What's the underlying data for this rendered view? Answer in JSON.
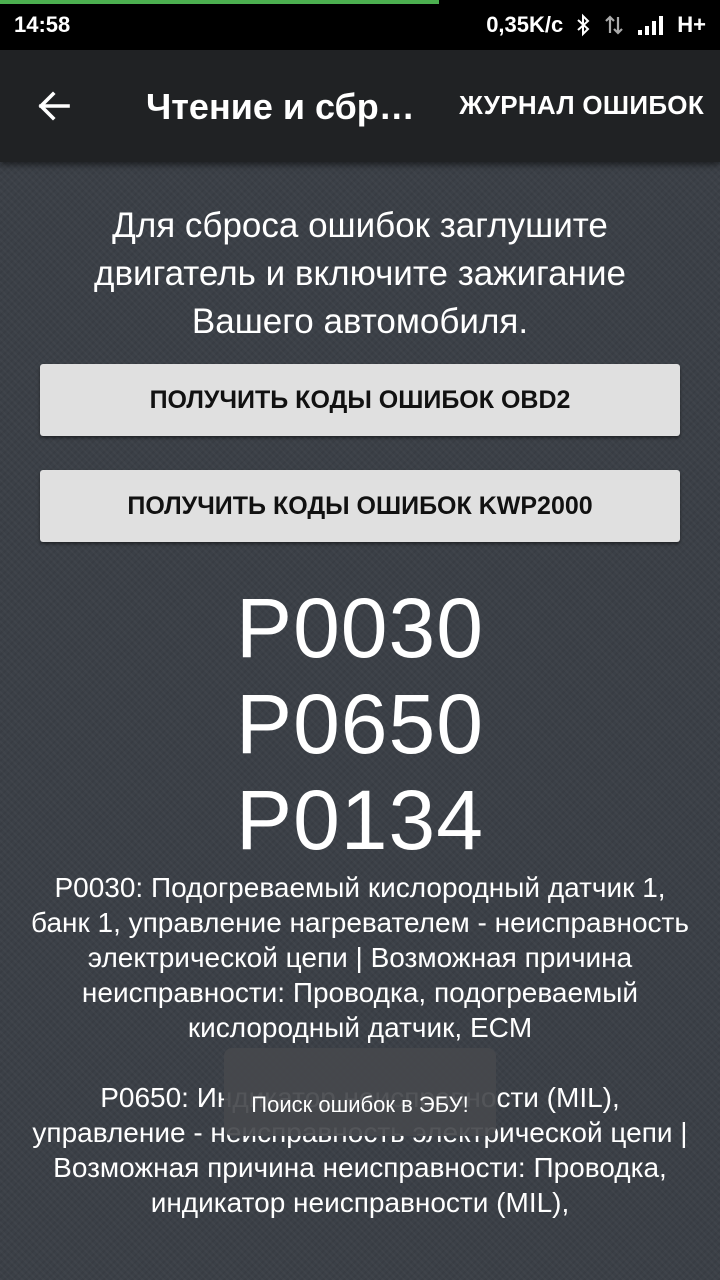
{
  "status_bar": {
    "time": "14:58",
    "network_speed": "0,35K/c",
    "network_type": "H+",
    "icons": [
      "bluetooth-icon",
      "data-transfer-icon",
      "signal-icon"
    ]
  },
  "app_bar": {
    "back_icon": "arrow-back-icon",
    "title": "Чтение и сброс ошибок",
    "journal_label": "ЖУРНАЛ ОШИБОК"
  },
  "main": {
    "instruction": "Для сброса ошибок заглушите двигатель и включите зажигание Вашего автомобиля.",
    "buttons": {
      "obd2": "ПОЛУЧИТЬ КОДЫ ОШИБОК OBD2",
      "kwp2000": "ПОЛУЧИТЬ КОДЫ ОШИБОК KWP2000"
    },
    "codes": [
      "P0030",
      "P0650",
      "P0134"
    ],
    "descriptions": [
      "P0030: Подогреваемый кислородный датчик 1, банк 1, управление нагревателем - неисправность электрической цепи | Возможная причина неисправности: Проводка, подогреваемый кислородный датчик, ECM",
      "P0650: Индикатор неисправности (MIL), управление - неисправность электрической цепи | Возможная причина неисправности: Проводка, индикатор неисправности (MIL),"
    ]
  },
  "toast": {
    "message": "Поиск ошибок в ЭБУ!"
  },
  "colors": {
    "progress": "#4caf50",
    "background": "#3b4047",
    "app_bar": "#202224",
    "button": "#e0e0e0"
  }
}
